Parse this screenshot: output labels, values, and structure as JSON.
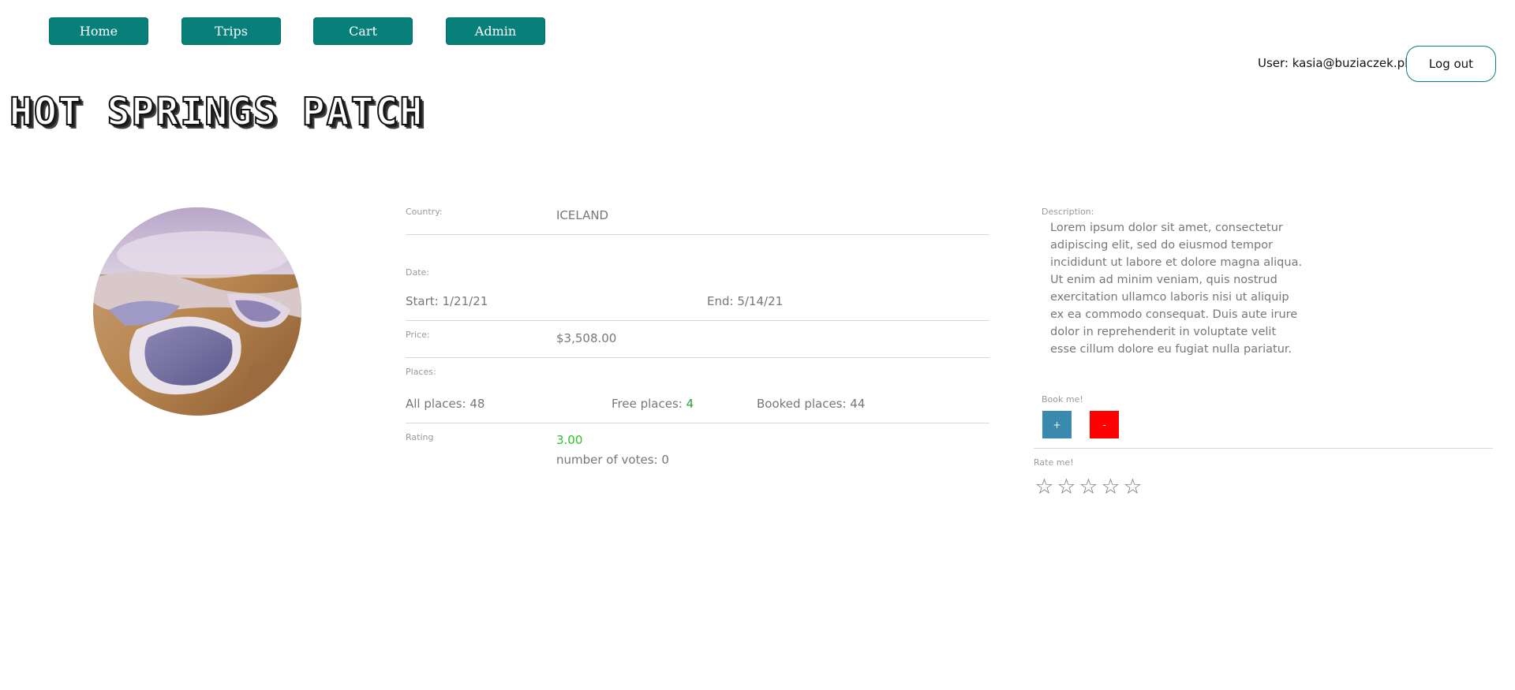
{
  "nav": {
    "home": "Home",
    "trips": "Trips",
    "cart": "Cart",
    "admin": "Admin"
  },
  "user": {
    "label": "User: kasia@buziaczek.pl",
    "logout": "Log out"
  },
  "trip": {
    "title": "HOT SPRINGS PATCH",
    "country_label": "Country:",
    "country": "ICELAND",
    "date_label": "Date:",
    "start": "Start: 1/21/21",
    "end": "End: 5/14/21",
    "price_label": "Price:",
    "price": "$3,508.00",
    "places_label": "Places:",
    "all_places_label": "All places: 48",
    "free_places_label": "Free places:",
    "free_places_value": "4",
    "booked_places_label": "Booked places: 44",
    "rating_label": "Rating",
    "rating_value": "3.00",
    "votes": "number of votes: 0",
    "description_label": "Description:",
    "description": "Lorem ipsum dolor sit amet, consectetur adipiscing elit, sed do eiusmod tempor incididunt ut labore et dolore magna aliqua. Ut enim ad minim veniam, quis nostrud exercitation ullamco laboris nisi ut aliquip ex ea commodo consequat. Duis aute irure dolor in reprehenderit in voluptate velit esse cillum dolore eu fugiat nulla pariatur.",
    "book_label": "Book me!",
    "book_plus": "+",
    "book_minus": "-",
    "rate_label": "Rate me!",
    "stars": [
      "☆",
      "☆",
      "☆",
      "☆",
      "☆"
    ]
  },
  "colors": {
    "nav_bg": "#08807a",
    "plus_btn": "#3a8ab0",
    "minus_btn": "#ff0000",
    "free_places": "#2fa12f",
    "rating": "#2ec22e"
  }
}
